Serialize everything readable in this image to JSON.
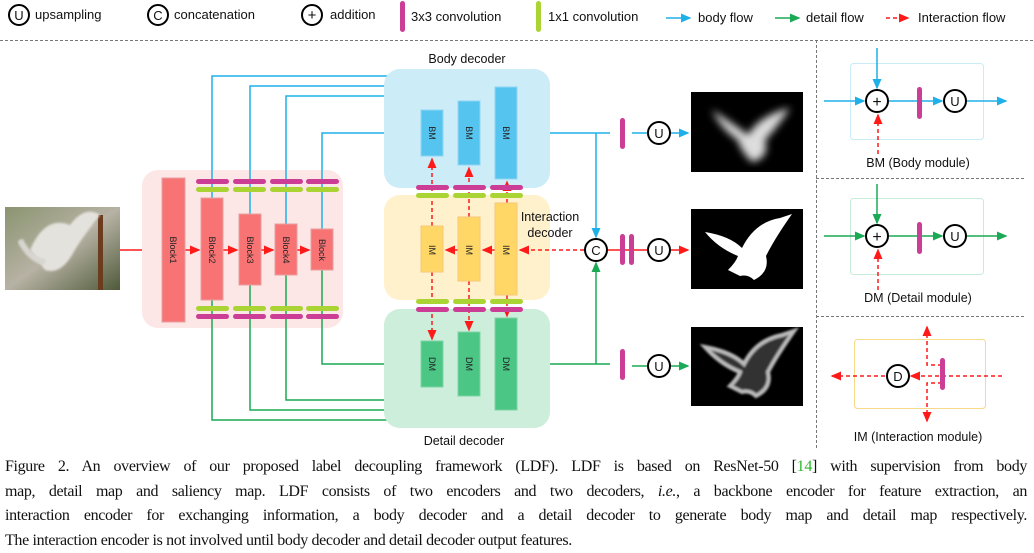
{
  "legend": {
    "upsampling_symbol": "U",
    "upsampling": "upsampling",
    "concat_symbol": "C",
    "concatenation": "concatenation",
    "addition_symbol": "+",
    "addition": "addition",
    "conv3": "3x3 convolution",
    "conv1": "1x1 convolution",
    "body_flow": "body flow",
    "detail_flow": "detail flow",
    "interaction_flow": "Interaction flow"
  },
  "colors": {
    "body": "#1fb0e8",
    "detail": "#1aaa55",
    "interaction": "#ff1a1a",
    "conv3": "#cc3d96",
    "conv1": "#aad434",
    "block": "#f87474",
    "bm": "#55c4ef",
    "im": "#ffd766",
    "dm": "#4cc685"
  },
  "encoder": {
    "blocks": [
      "Block1",
      "Block2",
      "Block3",
      "Block4",
      "Block"
    ]
  },
  "decoders": {
    "body_title": "Body decoder",
    "detail_title": "Detail decoder",
    "interaction_title_1": "Interaction",
    "interaction_title_2": "decoder",
    "bm": "BM",
    "im": "IM",
    "dm": "DM",
    "concat": "C",
    "up": "U"
  },
  "modules": {
    "bm_label": "BM (Body module)",
    "dm_label": "DM (Detail module)",
    "im_label": "IM (Interaction module)",
    "plus": "+",
    "up": "U",
    "d": "D"
  },
  "caption": {
    "l1a": "Figure 2. An overview of our proposed label decoupling framework (LDF). LDF is based on ResNet-50 [",
    "ref": "14",
    "l1b": "] with supervision from body",
    "l2a": "map, detail map and saliency map.  LDF consists of two encoders and two decoders, ",
    "ie": "i.e.",
    "l2b": ", a backbone encoder for feature extraction, an",
    "l3": "interaction encoder for exchanging information, a body decoder and a detail decoder to generate body map and detail map respectively.",
    "l4": "The interaction encoder is not involved until body decoder and detail decoder output features."
  }
}
